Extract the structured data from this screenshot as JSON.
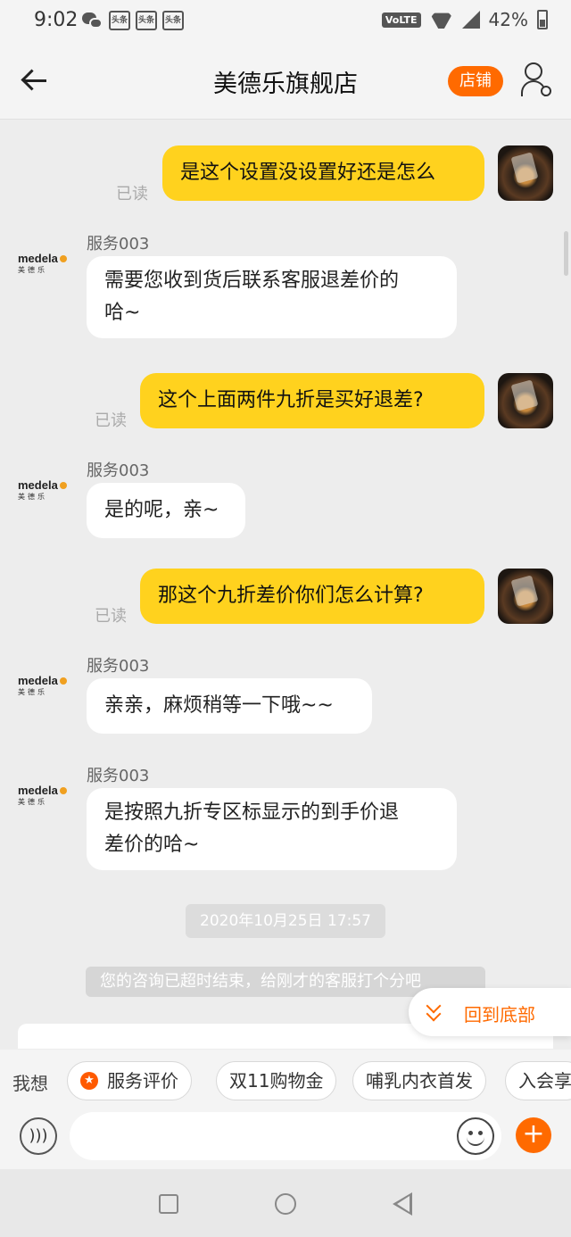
{
  "status_bar": {
    "time": "9:02",
    "app_badges": [
      "头条",
      "头条",
      "头条"
    ],
    "network": "VoLTE",
    "battery": "42%"
  },
  "header": {
    "title": "美德乐旗舰店",
    "shop_button": "店铺"
  },
  "agent": {
    "logo_text": "medela",
    "logo_cn": "美德乐",
    "name": "服务003"
  },
  "messages": [
    {
      "from": "me",
      "text": "是这个设置没设置好还是怎么",
      "status": "已读"
    },
    {
      "from": "agent",
      "sender": "服务003",
      "lines": [
        "需要您收到货后联系客服退差价的",
        "哈~"
      ]
    },
    {
      "from": "me",
      "text": "这个上面两件九折是买好退差?",
      "status": "已读"
    },
    {
      "from": "agent",
      "sender": "服务003",
      "lines": [
        "是的呢，亲~"
      ]
    },
    {
      "from": "me",
      "text": "那这个九折差价你们怎么计算?",
      "status": "已读"
    },
    {
      "from": "agent",
      "sender": "服务003",
      "lines": [
        "亲亲，麻烦稍等一下哦~~"
      ]
    },
    {
      "from": "agent",
      "sender": "服务003",
      "lines": [
        "是按照九折专区标显示的到手价退",
        "差价的哈~"
      ]
    }
  ],
  "date_stamp": "2020年10月25日 17:57",
  "system_notice": "您的咨询已超时结束，给刚才的客服打个分吧",
  "jump_to_bottom": "回到底部",
  "quick_bar": {
    "label": "我想",
    "chips": [
      "服务评价",
      "双11购物金",
      "哺乳内衣首发",
      "入会享"
    ]
  },
  "input": {
    "placeholder": ""
  },
  "colors": {
    "accent": "#ff6a00",
    "my_bubble": "#ffd21e",
    "background": "#ededed"
  }
}
